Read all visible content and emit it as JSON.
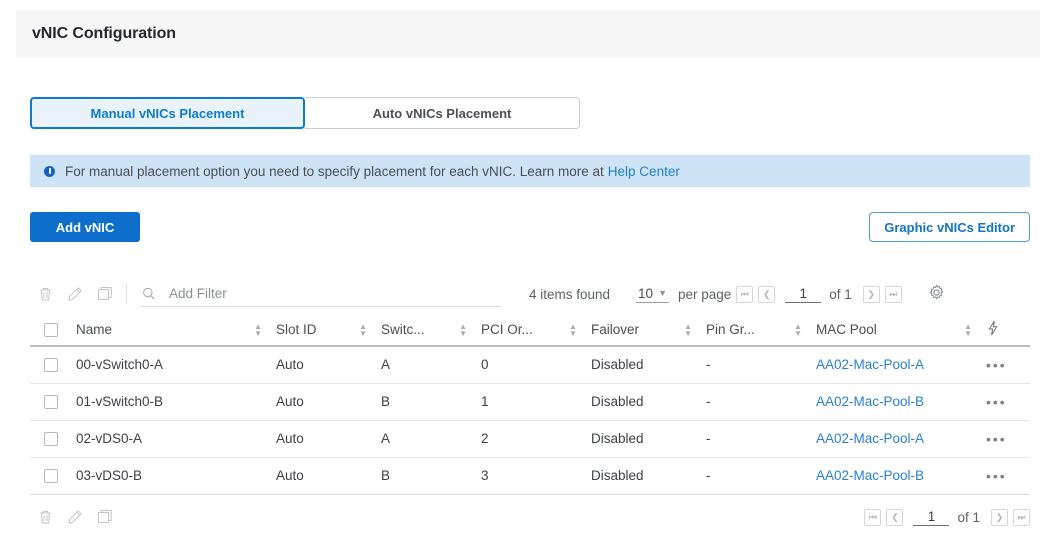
{
  "header": {
    "title": "vNIC Configuration"
  },
  "tabs": [
    {
      "label": "Manual vNICs Placement",
      "active": true
    },
    {
      "label": "Auto vNICs Placement",
      "active": false
    }
  ],
  "banner": {
    "icon": "info-circle-icon",
    "text": "For manual placement option you need to specify placement for each vNIC. Learn more at",
    "link_label": "Help Center"
  },
  "actions": {
    "add_vnic_label": "Add vNIC",
    "graphic_editor_label": "Graphic vNICs Editor"
  },
  "toolbar": {
    "delete_icon": "trash-icon",
    "edit_icon": "pencil-icon",
    "clone_icon": "copy-icon",
    "search_icon": "search-icon",
    "filter_placeholder": "Add Filter",
    "filter_value": "",
    "items_found": "4 items found",
    "per_page_value": "10",
    "per_page_label": "per page",
    "page_number": "1",
    "page_total": "of 1",
    "settings_icon": "gear-icon"
  },
  "table": {
    "columns": [
      {
        "label": "Name",
        "sortable": true
      },
      {
        "label": "Slot ID",
        "sortable": true
      },
      {
        "label": "Switc...",
        "sortable": true
      },
      {
        "label": "PCI Or...",
        "sortable": true
      },
      {
        "label": "Failover",
        "sortable": true
      },
      {
        "label": "Pin Gr...",
        "sortable": true
      },
      {
        "label": "MAC Pool",
        "sortable": true
      }
    ],
    "action_column_icon": "lightning-bolt-icon",
    "rows": [
      {
        "name": "00-vSwitch0-A",
        "slot_id": "Auto",
        "switch": "A",
        "pci_order": "0",
        "failover": "Disabled",
        "pin_group": "-",
        "mac_pool": "AA02-Mac-Pool-A",
        "menu": "•••"
      },
      {
        "name": "01-vSwitch0-B",
        "slot_id": "Auto",
        "switch": "B",
        "pci_order": "1",
        "failover": "Disabled",
        "pin_group": "-",
        "mac_pool": "AA02-Mac-Pool-B",
        "menu": "•••"
      },
      {
        "name": "02-vDS0-A",
        "slot_id": "Auto",
        "switch": "A",
        "pci_order": "2",
        "failover": "Disabled",
        "pin_group": "-",
        "mac_pool": "AA02-Mac-Pool-A",
        "menu": "•••"
      },
      {
        "name": "03-vDS0-B",
        "slot_id": "Auto",
        "switch": "B",
        "pci_order": "3",
        "failover": "Disabled",
        "pin_group": "-",
        "mac_pool": "AA02-Mac-Pool-B",
        "menu": "•••"
      }
    ]
  },
  "bottom": {
    "delete_icon": "trash-icon",
    "edit_icon": "pencil-icon",
    "clone_icon": "copy-icon",
    "page_number": "1",
    "page_total": "of 1"
  },
  "colors": {
    "accent": "#0d7bd4",
    "primary_button": "#0d6ecb",
    "link": "#2a7fd4",
    "banner_bg": "#cfe3f7",
    "header_bg": "#f6f6f7"
  }
}
